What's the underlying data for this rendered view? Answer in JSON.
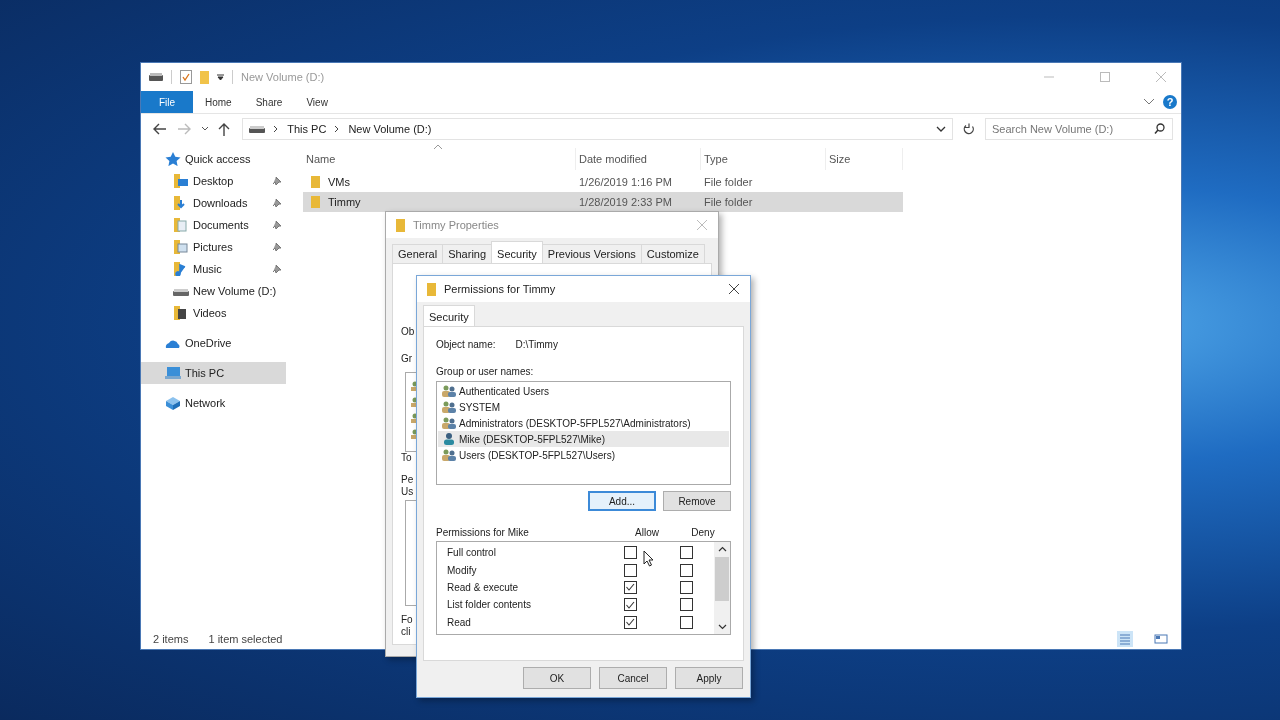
{
  "explorer": {
    "title": "New Volume (D:)",
    "ribbon_tabs": [
      {
        "label": "File",
        "selected": true
      },
      {
        "label": "Home",
        "selected": false
      },
      {
        "label": "Share",
        "selected": false
      },
      {
        "label": "View",
        "selected": false
      }
    ],
    "help": "?",
    "breadcrumb": [
      "This PC",
      "New Volume (D:)"
    ],
    "search": {
      "placeholder": "Search New Volume (D:)"
    },
    "sidebar": [
      {
        "label": "Quick access",
        "kind": "star",
        "selected": false,
        "children": [
          {
            "label": "Desktop",
            "kind": "desktop",
            "pinned": true,
            "selected": false
          },
          {
            "label": "Downloads",
            "kind": "downloads",
            "pinned": true,
            "selected": false
          },
          {
            "label": "Documents",
            "kind": "documents",
            "pinned": true,
            "selected": false
          },
          {
            "label": "Pictures",
            "kind": "pictures",
            "pinned": true,
            "selected": false
          },
          {
            "label": "Music",
            "kind": "music",
            "pinned": true,
            "selected": false
          },
          {
            "label": "New Volume (D:)",
            "kind": "drive",
            "pinned": false,
            "selected": false
          },
          {
            "label": "Videos",
            "kind": "videos",
            "pinned": false,
            "selected": false
          }
        ]
      },
      {
        "label": "OneDrive",
        "kind": "cloud",
        "selected": false
      },
      {
        "label": "This PC",
        "kind": "pc",
        "selected": true
      },
      {
        "label": "Network",
        "kind": "network",
        "selected": false
      }
    ],
    "columns": [
      "Name",
      "Date modified",
      "Type",
      "Size"
    ],
    "rows": [
      {
        "name": "VMs",
        "date": "1/26/2019 1:16 PM",
        "type": "File folder",
        "selected": false
      },
      {
        "name": "Timmy",
        "date": "1/28/2019 2:33 PM",
        "type": "File folder",
        "selected": true
      }
    ],
    "status": [
      "2 items",
      "1 item selected"
    ]
  },
  "properties": {
    "title": "Timmy Properties",
    "tabs": [
      {
        "label": "General",
        "selected": false
      },
      {
        "label": "Sharing",
        "selected": false
      },
      {
        "label": "Security",
        "selected": true
      },
      {
        "label": "Previous Versions",
        "selected": false
      },
      {
        "label": "Customize",
        "selected": false
      }
    ],
    "fragments": [
      "Ob",
      "Gr",
      "To",
      "Pe",
      "Us",
      "Fo",
      "cli"
    ]
  },
  "permissions": {
    "title": "Permissions for Timmy",
    "tabs": [
      {
        "label": "Security",
        "selected": true
      }
    ],
    "object_label": "Object name:",
    "object_value": "D:\\Timmy",
    "group_label": "Group or user names:",
    "users": [
      {
        "name": "Authenticated Users",
        "kind": "group",
        "selected": false
      },
      {
        "name": "SYSTEM",
        "kind": "group",
        "selected": false
      },
      {
        "name": "Administrators (DESKTOP-5FPL527\\Administrators)",
        "kind": "group",
        "selected": false
      },
      {
        "name": "Mike (DESKTOP-5FPL527\\Mike)",
        "kind": "user",
        "selected": true
      },
      {
        "name": "Users (DESKTOP-5FPL527\\Users)",
        "kind": "group",
        "selected": false
      }
    ],
    "user_buttons": [
      {
        "label": "Add...",
        "default": true
      },
      {
        "label": "Remove",
        "default": false
      }
    ],
    "perm_label": "Permissions for Mike",
    "allow_label": "Allow",
    "deny_label": "Deny",
    "perms": [
      {
        "name": "Full control",
        "allow": false,
        "deny": false
      },
      {
        "name": "Modify",
        "allow": false,
        "deny": false
      },
      {
        "name": "Read & execute",
        "allow": true,
        "deny": false
      },
      {
        "name": "List folder contents",
        "allow": true,
        "deny": false
      },
      {
        "name": "Read",
        "allow": true,
        "deny": false
      }
    ],
    "buttons": [
      "OK",
      "Cancel",
      "Apply"
    ]
  }
}
